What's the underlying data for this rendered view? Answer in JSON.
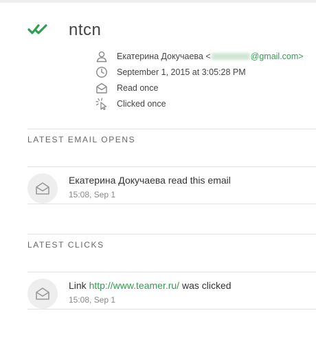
{
  "header": {
    "status_icon": "double-check-icon",
    "title": "ntcn"
  },
  "meta": {
    "sender_name": "Екатерина Докучаева",
    "sender_open": "<",
    "sender_domain": "@gmail.com>",
    "date": "September 1, 2015 at 3:05:28 PM",
    "read_status": "Read once",
    "click_status": "Clicked once"
  },
  "opens": {
    "section_title": "LATEST EMAIL OPENS",
    "items": [
      {
        "name": "Екатерина Докучаева",
        "action": " read this email",
        "time": "15:08, Sep 1"
      }
    ]
  },
  "clicks": {
    "section_title": "LATEST CLICKS",
    "items": [
      {
        "prefix": "Link ",
        "url": "http://www.teamer.ru/",
        "suffix": " was clicked",
        "time": "15:08, Sep 1"
      }
    ]
  },
  "colors": {
    "accent": "#2e9e4f",
    "icon": "#888888",
    "divider": "#e2e2e2"
  }
}
